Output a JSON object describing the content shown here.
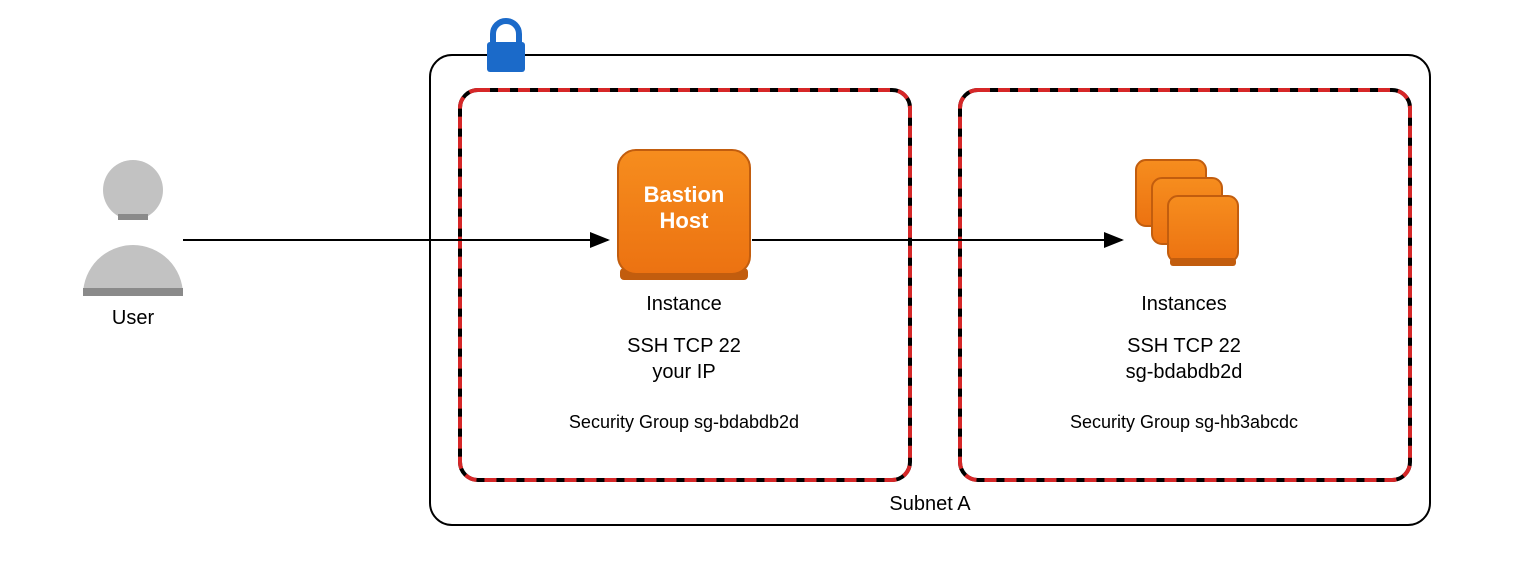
{
  "user": {
    "label": "User"
  },
  "subnet": {
    "label": "Subnet A"
  },
  "bastion_group": {
    "instance_label": "Instance",
    "bastion_title": "Bastion",
    "bastion_subtitle": "Host",
    "rule_line1": "SSH TCP 22",
    "rule_line2": "your IP",
    "sg_label": "Security Group sg-bdabdb2d"
  },
  "instances_group": {
    "instance_label": "Instances",
    "rule_line1": "SSH TCP 22",
    "rule_line2": "sg-bdabdb2d",
    "sg_label": "Security Group sg-hb3abcdc"
  },
  "colors": {
    "aws_orange": "#ec7211",
    "aws_orange_dark": "#c25d0e",
    "lock_blue": "#1b6ac9",
    "user_gray": "#c2c2c2",
    "user_gray_dark": "#8a8a8a"
  }
}
